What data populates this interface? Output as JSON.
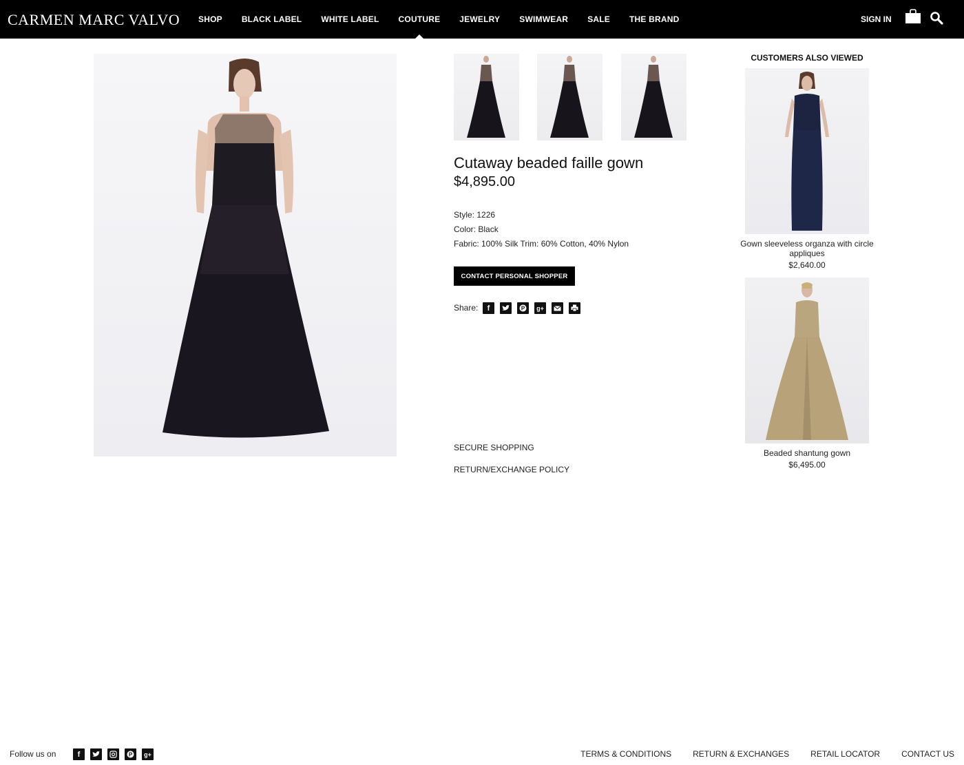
{
  "header": {
    "logo": "CARMEN MARC VALVO",
    "nav": [
      "SHOP",
      "BLACK LABEL",
      "WHITE LABEL",
      "COUTURE",
      "JEWELRY",
      "SWIMWEAR",
      "SALE",
      "THE BRAND"
    ],
    "active_nav": "COUTURE",
    "sign_in": "SIGN IN"
  },
  "product": {
    "title": "Cutaway beaded faille gown",
    "price": "$4,895.00",
    "style": "Style: 1226",
    "color": "Color: Black",
    "fabric": "Fabric: 100% Silk Trim: 60% Cotton, 40% Nylon",
    "contact_button": "CONTACT PERSONAL SHOPPER",
    "share_label": "Share:",
    "share_icons": [
      "facebook-icon",
      "twitter-icon",
      "pinterest-icon",
      "google-plus-icon",
      "email-icon",
      "print-icon"
    ],
    "secure_shopping": "SECURE SHOPPING",
    "return_policy": "RETURN/EXCHANGE POLICY"
  },
  "also_viewed": {
    "title": "CUSTOMERS ALSO VIEWED",
    "items": [
      {
        "name": "Gown sleeveless organza with circle appliques",
        "price": "$2,640.00"
      },
      {
        "name": "Beaded shantung gown",
        "price": "$6,495.00"
      }
    ]
  },
  "footer": {
    "follow": "Follow us on",
    "social_icons": [
      "facebook-icon",
      "twitter-icon",
      "instagram-icon",
      "pinterest-icon",
      "google-plus-icon"
    ],
    "links": [
      "TERMS & CONDITIONS",
      "RETURN & EXCHANGES",
      "RETAIL LOCATOR",
      "CONTACT US"
    ]
  },
  "colors": {
    "header_bg": "#000000",
    "button_bg": "#000000",
    "page_bg": "#ffffff"
  }
}
